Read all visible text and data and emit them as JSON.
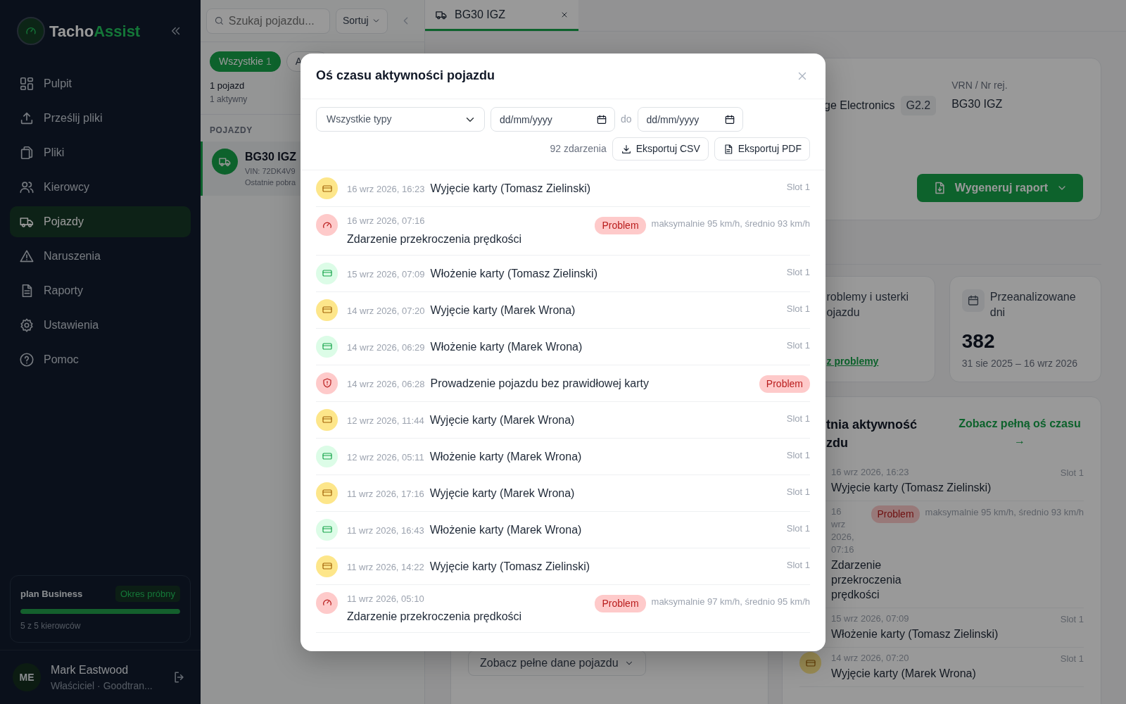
{
  "sidebar": {
    "logo_primary": "Tacho",
    "logo_accent": "Assist",
    "nav": [
      {
        "label": "Pulpit",
        "selected": false
      },
      {
        "label": "Prześlij pliki",
        "selected": false
      },
      {
        "label": "Pliki",
        "selected": false
      },
      {
        "label": "Kierowcy",
        "selected": false
      },
      {
        "label": "Pojazdy",
        "selected": true
      },
      {
        "label": "Naruszenia",
        "selected": false
      },
      {
        "label": "Raporty",
        "selected": false
      },
      {
        "label": "Ustawienia",
        "selected": false
      },
      {
        "label": "Pomoc",
        "selected": false
      }
    ],
    "plan": {
      "name": "plan Business",
      "badge": "Okres próbny",
      "level": 1,
      "usage": "5 z 5 kierowców"
    },
    "user": {
      "initials": "ME",
      "name": "Mark Eastwood",
      "role": "Właściciel · Goodtran..."
    }
  },
  "vehicle_panel": {
    "search_placeholder": "Szukaj pojazdu...",
    "sort": "Sortuj",
    "filters": [
      {
        "label": "Wszystkie",
        "count": "1",
        "selected": true
      },
      {
        "label": "A",
        "selected": false
      }
    ],
    "summary": "1 pojazd",
    "active": "1 aktywny",
    "section": "POJAZDY",
    "vehicles": [
      {
        "plate": "BG30 IGZ",
        "vin": "VIN: 72DK4V9",
        "last": "Ostatnie pobra",
        "selected": true
      }
    ]
  },
  "main": {
    "tabs": [
      {
        "label": "BG30 IGZ",
        "selected": true
      }
    ],
    "info": {
      "fields": [
        {
          "value": "ge Electronics",
          "tag": "G2.2"
        },
        {
          "label": "VRN / Nr rej.",
          "value": "BG30 IGZ"
        }
      ],
      "report_button": "Wygeneruj raport"
    },
    "stats": [
      {
        "title": "roblemy i usterki ojazdu",
        "link": "z problemy"
      },
      {
        "title": "Przeanalizowane dni",
        "value": "382",
        "range": "31 sie 2025 – 16 wrz 2026"
      }
    ],
    "details_button": "Zobacz pełne dane pojazdu",
    "activity": {
      "title": "tnia aktywność zdu",
      "link": "Zobacz pełną oś czasu →",
      "events": [
        {
          "date": "16 wrz 2026, 16:23",
          "title": "Wyjęcie karty (Tomasz Zielinski)",
          "slot": "Slot 1"
        },
        {
          "date": "16 wrz 2026, 07:16",
          "title": "Zdarzenie przekroczenia prędkości",
          "badge": "Problem",
          "detail": "maksymalnie 95 km/h, średnio 93 km/h"
        },
        {
          "date": "15 wrz 2026, 07:09",
          "title": "Włożenie karty (Tomasz Zielinski)",
          "slot": "Slot 1"
        },
        {
          "kind": "card_out",
          "date": "14 wrz 2026, 07:20",
          "title": "Wyjęcie karty (Marek Wrona)",
          "slot": "Slot 1"
        }
      ]
    }
  },
  "modal": {
    "title": "Oś czasu aktywności pojazdu",
    "type_filter": "Wszystkie typy",
    "date_from_placeholder": "dd/mm/yyyy",
    "range_separator": "do",
    "date_to_placeholder": "dd/mm/yyyy",
    "count": "92 zdarzenia",
    "export_csv": "Eksportuj CSV",
    "export_pdf": "Eksportuj PDF",
    "events": [
      {
        "kind": "card_out",
        "date": "16 wrz 2026, 16:23",
        "title": "Wyjęcie karty (Tomasz Zielinski)",
        "slot": "Slot 1"
      },
      {
        "kind": "speeding",
        "date": "16 wrz 2026, 07:16",
        "title": "Zdarzenie przekroczenia prędkości",
        "badge": "Problem",
        "detail": "maksymalnie 95 km/h, średnio 93 km/h"
      },
      {
        "kind": "card_in",
        "date": "15 wrz 2026, 07:09",
        "title": "Włożenie karty (Tomasz Zielinski)",
        "slot": "Slot 1"
      },
      {
        "kind": "card_out",
        "date": "14 wrz 2026, 07:20",
        "title": "Wyjęcie karty (Marek Wrona)",
        "slot": "Slot 1"
      },
      {
        "kind": "card_in",
        "date": "14 wrz 2026, 06:29",
        "title": "Włożenie karty (Marek Wrona)",
        "slot": "Slot 1"
      },
      {
        "kind": "no_card",
        "date": "14 wrz 2026, 06:28",
        "title": "Prowadzenie pojazdu bez prawidłowej karty",
        "badge": "Problem"
      },
      {
        "kind": "card_out",
        "date": "12 wrz 2026, 11:44",
        "title": "Wyjęcie karty (Marek Wrona)",
        "slot": "Slot 1"
      },
      {
        "kind": "card_in",
        "date": "12 wrz 2026, 05:11",
        "title": "Włożenie karty (Marek Wrona)",
        "slot": "Slot 1"
      },
      {
        "kind": "card_out",
        "date": "11 wrz 2026, 17:16",
        "title": "Wyjęcie karty (Marek Wrona)",
        "slot": "Slot 1"
      },
      {
        "kind": "card_in",
        "date": "11 wrz 2026, 16:43",
        "title": "Włożenie karty (Marek Wrona)",
        "slot": "Slot 1"
      },
      {
        "kind": "card_out",
        "date": "11 wrz 2026, 14:22",
        "title": "Wyjęcie karty (Tomasz Zielinski)",
        "slot": "Slot 1"
      },
      {
        "kind": "speeding",
        "date": "11 wrz 2026, 05:10",
        "title": "Zdarzenie przekroczenia prędkości",
        "badge": "Problem",
        "detail": "maksymalnie 97 km/h, średnio 95 km/h"
      }
    ]
  }
}
